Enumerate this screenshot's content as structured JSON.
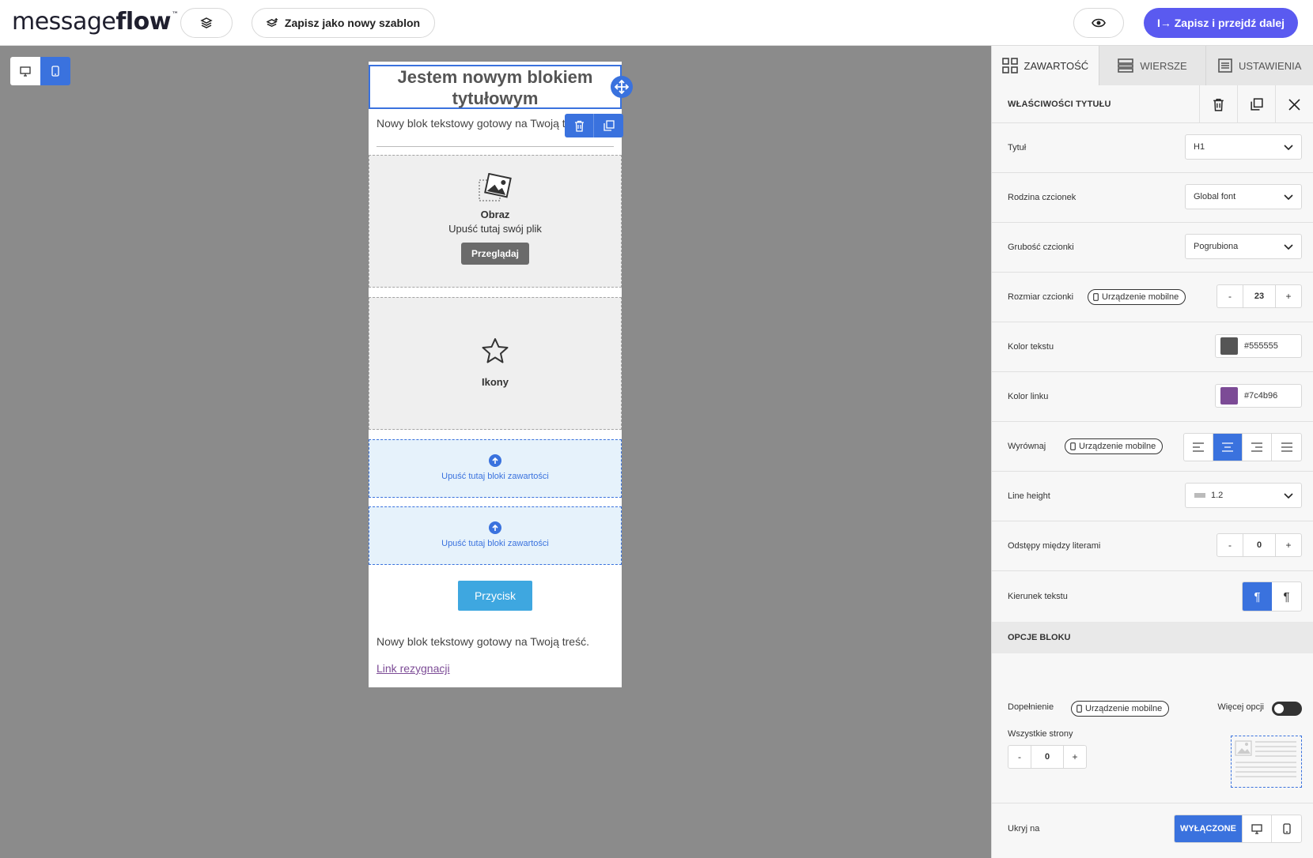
{
  "app": {
    "logo_light": "message",
    "logo_bold": "flow",
    "logo_tm": "™"
  },
  "topbar": {
    "save_template_label": "Zapisz jako nowy szablon",
    "save_continue_label": "I→ Zapisz i przejdź dalej",
    "accent_color": "#5a5af0"
  },
  "canvas": {
    "title_text": "Jestem nowym blokiem tytułowym",
    "text_block_1": "Nowy blok tekstowy gotowy na Twoją treść.",
    "image_placeholder": {
      "title": "Obraz",
      "subtitle": "Upuść tutaj swój plik",
      "browse_label": "Przeglądaj"
    },
    "icons_placeholder": {
      "title": "Ikony"
    },
    "dropzones": [
      {
        "label": "Upuść tutaj bloki zawartości"
      },
      {
        "label": "Upuść tutaj bloki zawartości"
      }
    ],
    "button_label": "Przycisk",
    "text_block_2": "Nowy blok tekstowy gotowy na Twoją treść.",
    "unsubscribe_link": "Link rezygnacji"
  },
  "panel": {
    "tabs": [
      {
        "label": "ZAWARTOŚĆ",
        "icon": "grid-icon",
        "active": true
      },
      {
        "label": "WIERSZE",
        "icon": "rows-icon",
        "active": false
      },
      {
        "label": "USTAWIENIA",
        "icon": "settings-doc-icon",
        "active": false
      }
    ],
    "header_title": "WŁAŚCIWOŚCI TYTUŁU",
    "properties": {
      "heading": {
        "label": "Tytuł",
        "value": "H1"
      },
      "font_family": {
        "label": "Rodzina czcionek",
        "value": "Global font"
      },
      "font_weight": {
        "label": "Grubość czcionki",
        "value": "Pogrubiona"
      },
      "font_size": {
        "label": "Rozmiar czcionki",
        "badge": "Urządzenie mobilne",
        "value": "23",
        "minus": "-",
        "plus": "+"
      },
      "text_color": {
        "label": "Kolor tekstu",
        "value": "#555555"
      },
      "link_color": {
        "label": "Kolor linku",
        "value": "#7c4b96"
      },
      "align": {
        "label": "Wyrównaj",
        "badge": "Urządzenie mobilne",
        "selected": "center"
      },
      "line_height": {
        "label": "Line height",
        "value": "1.2"
      },
      "letter_spacing": {
        "label": "Odstępy między literami",
        "value": "0",
        "minus": "-",
        "plus": "+"
      },
      "text_direction": {
        "label": "Kierunek tekstu",
        "ltr_glyph": "¶",
        "rtl_glyph": "¶"
      }
    },
    "block_options": {
      "section_title": "OPCJE BLOKU",
      "padding": {
        "label": "Dopełnienie",
        "badge": "Urządzenie mobilne",
        "more_options": "Więcej opcji",
        "all_sides_label": "Wszystkie strony",
        "value": "0",
        "minus": "-",
        "plus": "+"
      },
      "hide_on": {
        "label": "Ukryj na",
        "off_label": "WYŁĄCZONE"
      }
    }
  }
}
